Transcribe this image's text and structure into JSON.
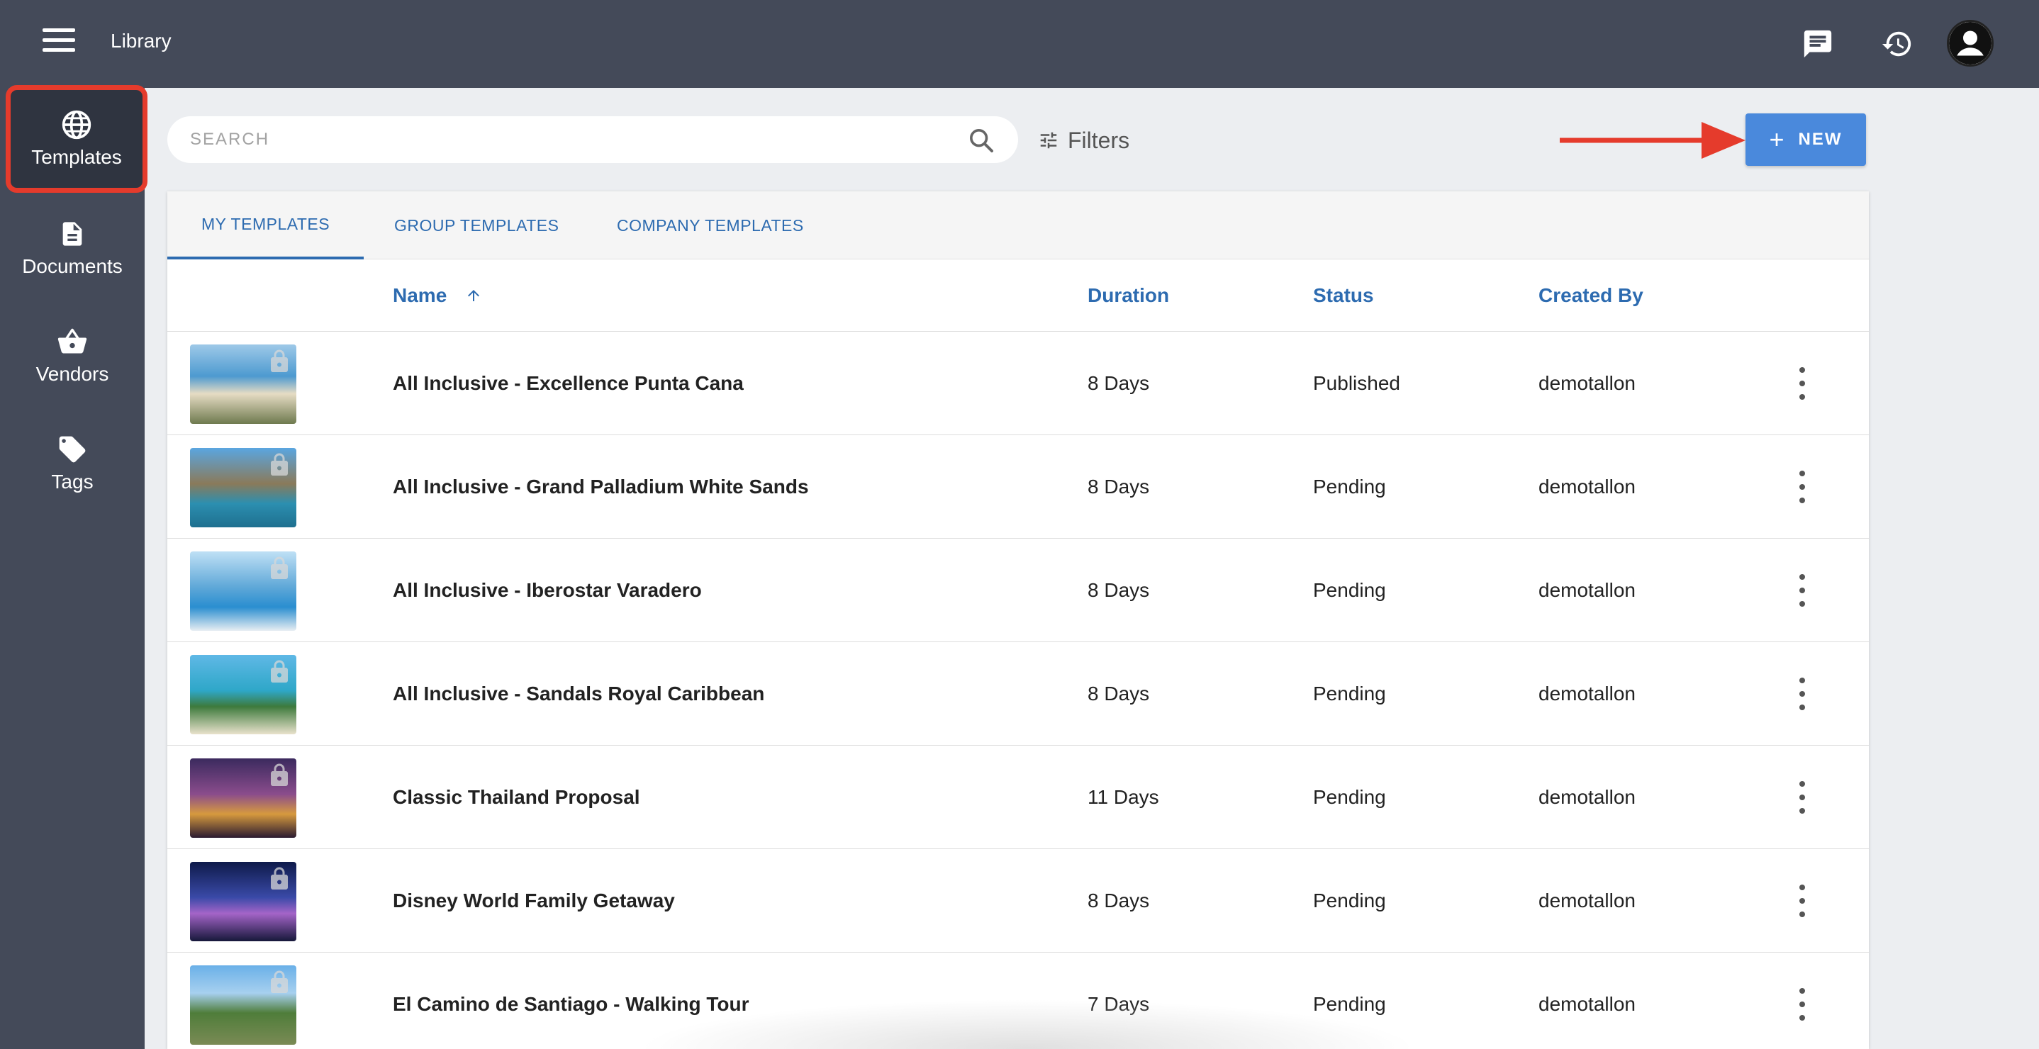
{
  "header": {
    "title": "Library",
    "icons": [
      "menu-icon",
      "chat-icon",
      "history-icon",
      "avatar-icon"
    ]
  },
  "sidebar": {
    "items": [
      {
        "label": "Templates",
        "icon": "globe-icon",
        "active": true
      },
      {
        "label": "Documents",
        "icon": "document-icon",
        "active": false
      },
      {
        "label": "Vendors",
        "icon": "basket-icon",
        "active": false
      },
      {
        "label": "Tags",
        "icon": "tag-icon",
        "active": false
      }
    ]
  },
  "toolbar": {
    "search_placeholder": "SEARCH",
    "filters_label": "Filters",
    "new_label": "NEW"
  },
  "tabs": [
    {
      "label": "MY TEMPLATES",
      "active": true
    },
    {
      "label": "GROUP TEMPLATES",
      "active": false
    },
    {
      "label": "COMPANY TEMPLATES",
      "active": false
    }
  ],
  "table": {
    "columns": [
      "Name",
      "Duration",
      "Status",
      "Created By"
    ],
    "sort": {
      "column": "Name",
      "direction": "ascending"
    },
    "rows": [
      {
        "name": "All Inclusive - Excellence Punta Cana",
        "duration": "8 Days",
        "status": "Published",
        "created_by": "demotallon"
      },
      {
        "name": "All Inclusive - Grand Palladium White Sands",
        "duration": "8 Days",
        "status": "Pending",
        "created_by": "demotallon"
      },
      {
        "name": "All Inclusive - Iberostar Varadero",
        "duration": "8 Days",
        "status": "Pending",
        "created_by": "demotallon"
      },
      {
        "name": "All Inclusive - Sandals Royal Caribbean",
        "duration": "8 Days",
        "status": "Pending",
        "created_by": "demotallon"
      },
      {
        "name": "Classic Thailand Proposal",
        "duration": "11 Days",
        "status": "Pending",
        "created_by": "demotallon"
      },
      {
        "name": "Disney World Family Getaway",
        "duration": "8 Days",
        "status": "Pending",
        "created_by": "demotallon"
      },
      {
        "name": "El Camino de Santiago - Walking Tour",
        "duration": "7 Days",
        "status": "Pending",
        "created_by": "demotallon"
      }
    ]
  },
  "colors": {
    "topbar": "#444a59",
    "accent": "#2d6bb0",
    "new_button": "#4a89dc",
    "highlight": "#e53b2c"
  }
}
